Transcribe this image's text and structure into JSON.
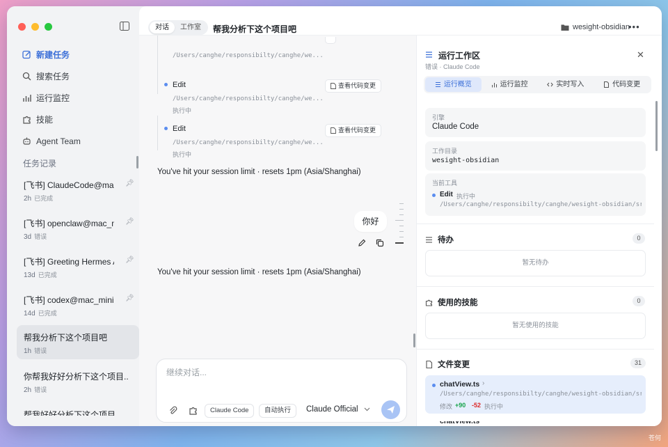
{
  "sidebar": {
    "nav": [
      {
        "label": "新建任务",
        "icon": "edit-square-icon",
        "active": true
      },
      {
        "label": "搜索任务",
        "icon": "search-icon",
        "active": false
      },
      {
        "label": "运行监控",
        "icon": "bar-chart-icon",
        "active": false
      },
      {
        "label": "技能",
        "icon": "puzzle-icon",
        "active": false
      },
      {
        "label": "Agent Team",
        "icon": "robot-icon",
        "active": false
      }
    ],
    "section_title": "任务记录",
    "tasks": [
      {
        "title": "[飞书] ClaudeCode@mac_",
        "time": "2h",
        "status": "已完成",
        "pinned": true
      },
      {
        "title": "[飞书] openclaw@mac_mi",
        "time": "3d",
        "status": "错误",
        "pinned": true
      },
      {
        "title": "[飞书] Greeting Hermes A",
        "time": "13d",
        "status": "已完成",
        "pinned": true
      },
      {
        "title": "[飞书] codex@mac_mini",
        "time": "14d",
        "status": "已完成",
        "pinned": true
      },
      {
        "title": "帮我分析下这个项目吧",
        "time": "1h",
        "status": "错误",
        "pinned": false,
        "active": true
      },
      {
        "title": "你帮我好好分析下这个项目...",
        "time": "2h",
        "status": "错误",
        "pinned": false
      },
      {
        "title": "帮我好好分析下这个项目",
        "time": "",
        "status": "",
        "pinned": false
      }
    ]
  },
  "header": {
    "tabs": [
      "对话",
      "工作室"
    ],
    "title": "帮我分析下这个项目吧",
    "folder": "wesight-obsidian",
    "more": "•••"
  },
  "chat": {
    "tool_calls": [
      {
        "name": "",
        "path": "/Users/canghe/responsibilty/canghe/we...",
        "status": ""
      },
      {
        "name": "Edit",
        "path": "/Users/canghe/responsibilty/canghe/we...",
        "status": "执行中",
        "button": "查看代码变更"
      },
      {
        "name": "Edit",
        "path": "/Users/canghe/responsibilty/canghe/we...",
        "status": "执行中",
        "button": "查看代码变更"
      }
    ],
    "limit_message_1": "You've hit your session limit · resets 1pm (Asia/Shanghai)",
    "user_bubble": "你好",
    "limit_message_2": "You've hit your session limit · resets 1pm (Asia/Shanghai)"
  },
  "composer": {
    "placeholder": "继续对话...",
    "pill_agent": "Claude Code",
    "pill_mode": "自动执行",
    "model": "Claude Official"
  },
  "panel": {
    "title": "运行工作区",
    "subtitle": "错误 · Claude Code",
    "tabs": [
      {
        "label": "运行概览",
        "icon": "list-icon",
        "active": true
      },
      {
        "label": "运行监控",
        "icon": "bar-chart-icon",
        "active": false
      },
      {
        "label": "实时写入",
        "icon": "code-icon",
        "active": false
      },
      {
        "label": "代码变更",
        "icon": "file-icon",
        "active": false
      }
    ],
    "engine_label": "引擎",
    "engine_value": "Claude Code",
    "dir_label": "工作目录",
    "dir_value": "wesight-obsidian",
    "tool_label": "当前工具",
    "tool_name": "Edit",
    "tool_status": "执行中",
    "tool_path": "/Users/canghe/responsibilty/canghe/wesight-obsidian/src...",
    "todo_title": "待办",
    "todo_count": "0",
    "todo_empty": "暂无待办",
    "skills_title": "使用的技能",
    "skills_count": "0",
    "skills_empty": "暂无使用的技能",
    "files_title": "文件变更",
    "files_count": "31",
    "file_name": "chatView.ts",
    "file_path": "/Users/canghe/responsibilty/canghe/wesight-obsidian/src...",
    "file_action": "修改",
    "file_add": "+90",
    "file_del": "-52",
    "file_status": "执行中",
    "file_next": "chatView.ts"
  },
  "colors": {
    "accent": "#3b6fd8",
    "add": "#16a34a",
    "del": "#dc2626"
  },
  "watermark": "苍何"
}
